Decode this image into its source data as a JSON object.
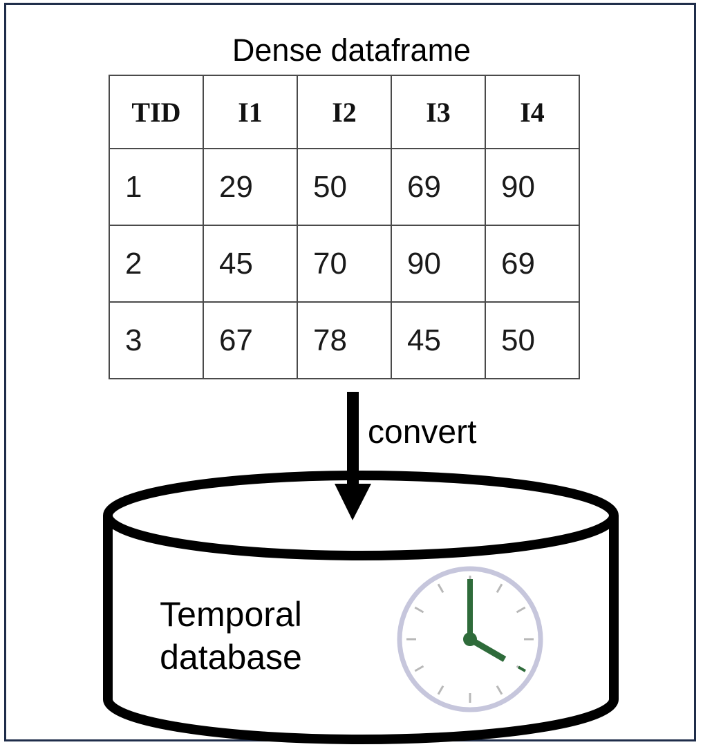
{
  "title": "Dense dataframe",
  "table": {
    "headers": [
      "TID",
      "I1",
      "I2",
      "I3",
      "I4"
    ],
    "rows": [
      [
        "1",
        "29",
        "50",
        "69",
        "90"
      ],
      [
        "2",
        "45",
        "70",
        "90",
        "69"
      ],
      [
        "3",
        "67",
        "78",
        "45",
        "50"
      ]
    ]
  },
  "arrow_label": "convert",
  "database": {
    "line1": "Temporal",
    "line2": "database",
    "icon": "clock-icon"
  },
  "colors": {
    "frame": "#1f2d4a",
    "clock_hands": "#2e6b3a",
    "clock_rim": "#c6c6dc",
    "clock_ticks": "#b8b8b8"
  }
}
